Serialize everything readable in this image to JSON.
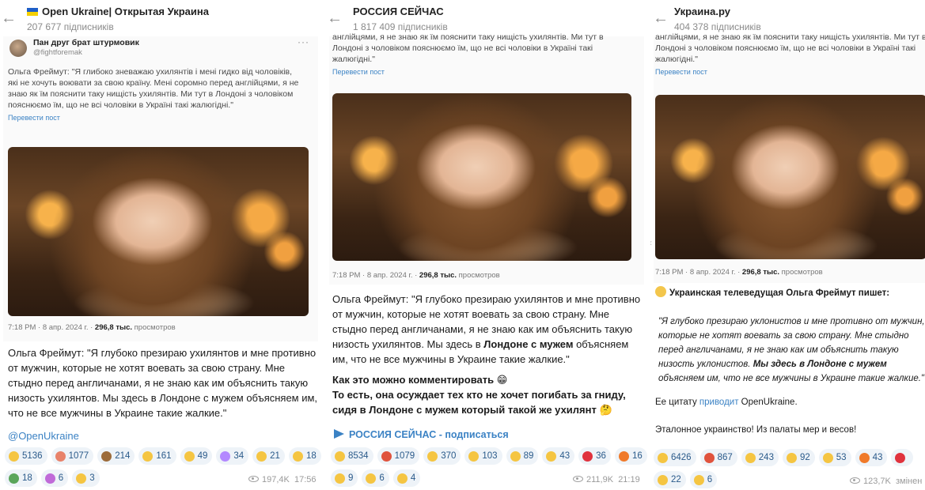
{
  "panel1": {
    "channel_title": "Open Ukraine| Открытая Украина",
    "subscribers": "207 677 підписників",
    "tweet": {
      "author": "Пан друг брат штурмовик",
      "handle": "@fightforemak",
      "text": "Ольга Фреймут: \"Я глибоко зневажаю ухилянтів і мені гидко від чоловіків, які не хочуть воювати за свою країну. Мені соромно перед англійцями, я не знаю як їм пояснити таку нищість ухилянтів. Ми тут в Лондоні з чоловіком пояснюємо їм, що не всі чоловіки в Україні такі жалюгідні.\"",
      "translate_link": "Перевести пост",
      "meta_time": "7:18 PM · 8 апр. 2024 г. · ",
      "meta_views": "296,8 тыс.",
      "meta_views_label": " просмотров"
    },
    "post_text": "Ольга Фреймут: \"Я глубоко презираю ухилянтов и мне противно от мужчин, которые не хотят воевать за свою страну. Мне стыдно перед англичанами, я не знаю как им объяснить такую низость ухилянтов. Мы здесь в Лондоне с мужем объясняем им, что не все мужчины в Украине такие жалкие.\"",
    "mention": "@OpenUkraine",
    "reactions": [
      {
        "icon": "rofl-emoji",
        "count": "5136",
        "color": "#f5c542"
      },
      {
        "icon": "clown-emoji",
        "count": "1077",
        "color": "#e8826a"
      },
      {
        "icon": "poop-emoji",
        "count": "214",
        "color": "#9c6b3a"
      },
      {
        "icon": "grin-emoji",
        "count": "161",
        "color": "#f5c542"
      },
      {
        "icon": "thumbs-up-emoji",
        "count": "49",
        "color": "#f5c542"
      },
      {
        "icon": "unicorn-emoji",
        "count": "34",
        "color": "#b388ff"
      },
      {
        "icon": "middle-finger-emoji",
        "count": "21",
        "color": "#f5c542"
      },
      {
        "icon": "writing-hand-emoji",
        "count": "18",
        "color": "#f5c542"
      },
      {
        "icon": "bottle-emoji",
        "count": "18",
        "color": "#5aa55a"
      },
      {
        "icon": "syringe-emoji",
        "count": "6",
        "color": "#c06ad8"
      },
      {
        "icon": "thumbs-down-emoji",
        "count": "3",
        "color": "#f5c542"
      }
    ],
    "views": "197,4K",
    "time": "17:56"
  },
  "panel2": {
    "channel_title": "РОССИЯ СЕЙЧАС",
    "subscribers": "1 817 409 підписників",
    "tweet": {
      "text": "англійцями, я не знаю як їм пояснити таку нищість ухилянтів. Ми тут в Лондоні з чоловіком пояснюємо їм, що не всі чоловіки в Україні такі жалюгідні.\"",
      "translate_link": "Перевести пост",
      "meta_time": "7:18 PM · 8 апр. 2024 г. · ",
      "meta_views": "296,8 тыс.",
      "meta_views_label": " просмотров"
    },
    "post_text_1": "Ольга Фреймут: \"Я глубоко презираю ухилянтов и мне противно от мужчин, которые не хотят воевать за свою страну. Мне стыдно перед англичанами, я не знаю как им объяснить такую низость ухилянтов. Мы здесь в ",
    "post_text_bold": "Лондоне с мужем",
    "post_text_2": " объясняем им, что не все мужчины в Украине такие жалкие.\"",
    "comment_1": "Как это можно комментировать 😁",
    "comment_2": "То есть, она осуждает тех кто не хочет погибать за гниду, сидя в Лондоне с мужем который такой же ухилянт 🤔",
    "subscribe_line": "РОССИЯ СЕЙЧАС - подписаться",
    "reactions": [
      {
        "icon": "grin-emoji",
        "count": "8534",
        "color": "#f5c542"
      },
      {
        "icon": "angry-emoji",
        "count": "1079",
        "color": "#e0533d"
      },
      {
        "icon": "thumbs-up-emoji",
        "count": "370",
        "color": "#f5c542"
      },
      {
        "icon": "thumbs-down-emoji",
        "count": "103",
        "color": "#f5c542"
      },
      {
        "icon": "thinking-emoji",
        "count": "89",
        "color": "#f5c542"
      },
      {
        "icon": "scream-emoji",
        "count": "43",
        "color": "#f5c542"
      },
      {
        "icon": "heart-emoji",
        "count": "36",
        "color": "#e0323d"
      },
      {
        "icon": "fire-emoji",
        "count": "16",
        "color": "#f07a2a"
      },
      {
        "icon": "clap-emoji",
        "count": "9",
        "color": "#f5c542"
      },
      {
        "icon": "pray-emoji",
        "count": "6",
        "color": "#f5c542"
      },
      {
        "icon": "cry-emoji",
        "count": "4",
        "color": "#f5c542"
      }
    ],
    "views": "211,9K",
    "time": "21:19"
  },
  "panel3": {
    "channel_title": "Украина.ру",
    "subscribers": "404 378 підписників",
    "tweet": {
      "text": "англійцями, я не знаю як їм пояснити таку нищість ухилянтів. Ми тут в Лондоні з чоловіком пояснюємо їм, що не всі чоловіки в Україні такі жалюгідні.\"",
      "translate_link": "Перевести пост",
      "meta_time": "7:18 PM · 8 апр. 2024 г. · ",
      "meta_views": "296,8 тыс.",
      "meta_views_label": " просмотров"
    },
    "headline": "Украинская телеведущая Ольга Фреймут пишет:",
    "quote_1": "\"Я глубоко презираю уклонистов и мне противно от мужчин, которые не хотят воевать за свою страну. Мне стыдно перед англичанами, я не знаю как им объяснить такую низость уклонистов. ",
    "quote_bold": "Мы здесь в Лондоне с мужем",
    "quote_2": " объясняем им, что не все мужчины в Украине такие жалкие.\"",
    "cite_prefix": "Ее цитату ",
    "cite_link": "приводит",
    "cite_suffix": " OpenUkraine.",
    "closing": "Эталонное украинство! Из палаты мер и весов!",
    "reactions": [
      {
        "icon": "grin-emoji",
        "count": "6426",
        "color": "#f5c542"
      },
      {
        "icon": "angry-emoji",
        "count": "867",
        "color": "#e0533d"
      },
      {
        "icon": "thumbs-up-emoji",
        "count": "243",
        "color": "#f5c542"
      },
      {
        "icon": "thumbs-down-emoji",
        "count": "92",
        "color": "#f5c542"
      },
      {
        "icon": "scream-emoji",
        "count": "53",
        "color": "#f5c542"
      },
      {
        "icon": "fire-emoji",
        "count": "43",
        "color": "#f07a2a"
      },
      {
        "icon": "heart-emoji",
        "count": "",
        "color": "#e0323d"
      },
      {
        "icon": "thinking-emoji",
        "count": "22",
        "color": "#f5c542"
      },
      {
        "icon": "cry-emoji",
        "count": "6",
        "color": "#f5c542"
      }
    ],
    "views": "123,7K",
    "edited": "змінен"
  }
}
